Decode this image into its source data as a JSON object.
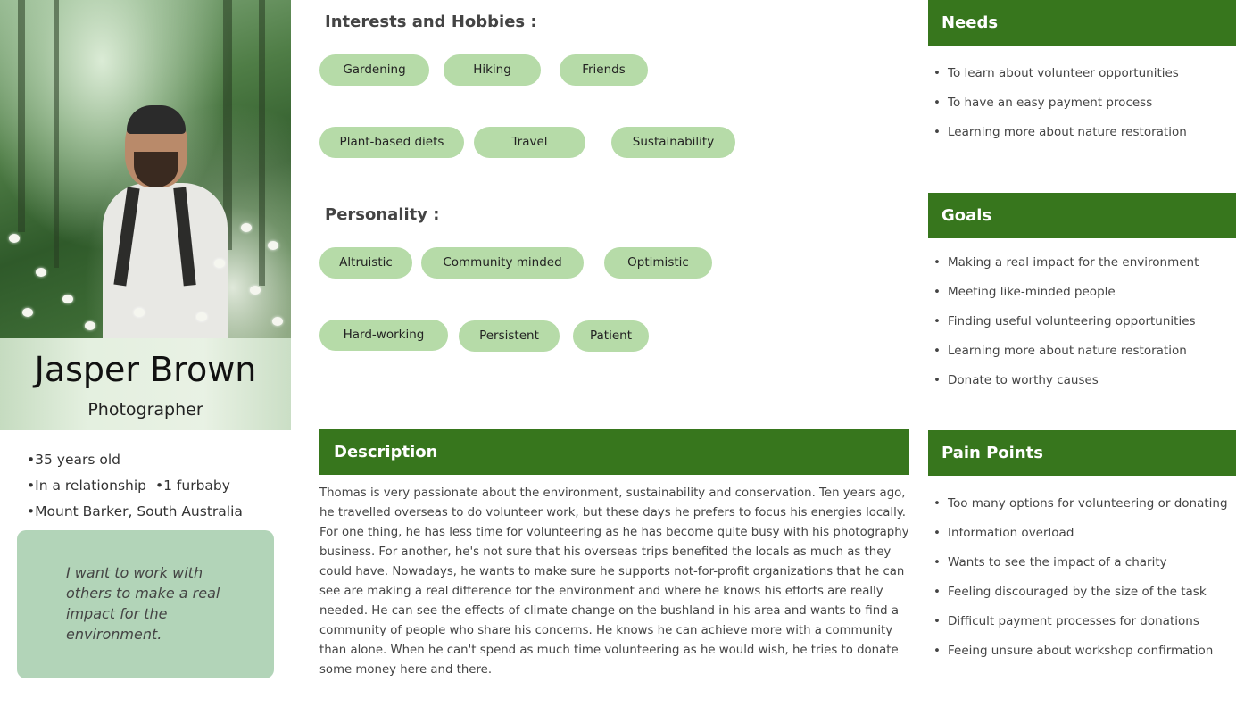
{
  "profile": {
    "name": "Jasper Brown",
    "role": "Photographer",
    "facts": [
      [
        "•35 years old"
      ],
      [
        "•In a relationship",
        "•1 furbaby"
      ],
      [
        "•Mount Barker, South Australia"
      ]
    ],
    "quote": "I want to work with others to make a real impact for the environment."
  },
  "interests": {
    "label": "Interests and Hobbies :",
    "row1": [
      "Gardening",
      "Hiking",
      "Friends"
    ],
    "row2": [
      "Plant-based diets",
      "Travel",
      "Sustainability"
    ]
  },
  "personality": {
    "label": "Personality :",
    "row1": [
      "Altruistic",
      "Community minded",
      "Optimistic"
    ],
    "row2": [
      "Hard-working",
      "Persistent",
      "Patient"
    ]
  },
  "description": {
    "title": "Description",
    "text": "Thomas is very passionate about the environment, sustainability and conservation. Ten years ago, he travelled overseas to do volunteer work, but these days he prefers to focus his energies locally. For one thing, he has less time for volunteering as he has become quite busy with his photography business. For another, he's not sure that his overseas trips benefited the locals as much as they could have. Nowadays, he wants to make sure he supports not-for-profit organizations that he can see are making a real difference for the environment and where he knows his efforts are really needed. He can see the effects of climate change on the bushland in his area and wants to find a community of people who share his concerns.  He knows he can achieve more with  a community than alone. When he can't spend as much time volunteering as he would wish, he tries to donate some money here and there."
  },
  "needs": {
    "title": "Needs",
    "items": [
      "To learn about volunteer opportunities",
      "To have an easy payment process",
      "Learning more about nature restoration"
    ]
  },
  "goals": {
    "title": "Goals",
    "items": [
      "Making a real impact for the environment",
      "Meeting like-minded people",
      "Finding useful volunteering opportunities",
      "Learning more about nature restoration",
      "Donate to worthy causes"
    ]
  },
  "pain_points": {
    "title": "Pain Points",
    "items": [
      "Too many options for volunteering or donating",
      "Information overload",
      "Wants to see the impact of a charity",
      "Feeling discouraged by the size of the task",
      "Difficult payment processes for donations",
      "Feeing unsure about workshop confirmation"
    ]
  },
  "colors": {
    "header_green": "#37761d",
    "pill_green": "#b6dba8",
    "quote_green": "#b2d4b8"
  }
}
